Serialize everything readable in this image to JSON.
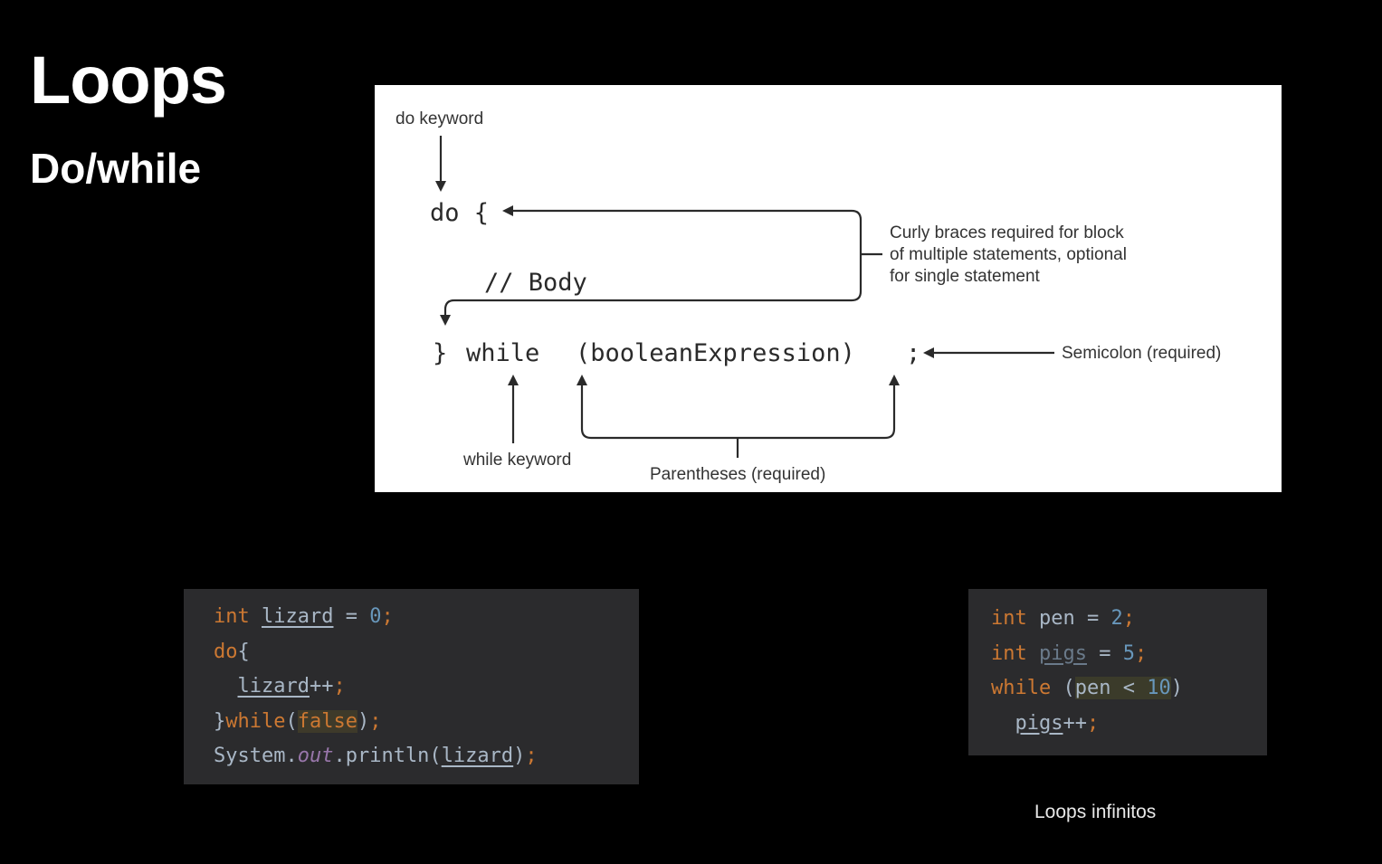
{
  "slide": {
    "title": "Loops",
    "subtitle": "Do/while",
    "caption": "Loops infinitos"
  },
  "diagram": {
    "code_do": "do  {",
    "code_body": "// Body",
    "code_close": "}",
    "code_while": "while",
    "code_expr": "(booleanExpression)",
    "code_semi": ";",
    "label_do_keyword": "do keyword",
    "label_braces_1": "Curly braces required for block",
    "label_braces_2": "of multiple statements, optional",
    "label_braces_3": "for single statement",
    "label_semicolon": "Semicolon (required)",
    "label_while_keyword": "while keyword",
    "label_parentheses": "Parentheses (required)"
  },
  "code_left": {
    "lines": [
      [
        {
          "t": "int",
          "c": "kw"
        },
        {
          "t": " ",
          "c": ""
        },
        {
          "t": "lizard",
          "c": "var"
        },
        {
          "t": " = ",
          "c": ""
        },
        {
          "t": "0",
          "c": "num"
        },
        {
          "t": ";",
          "c": "pun"
        }
      ],
      [
        {
          "t": "do",
          "c": "kw"
        },
        {
          "t": "{",
          "c": ""
        }
      ],
      [
        {
          "t": "  ",
          "c": ""
        },
        {
          "t": "lizard",
          "c": "var"
        },
        {
          "t": "++",
          "c": ""
        },
        {
          "t": ";",
          "c": "pun"
        }
      ],
      [
        {
          "t": "}",
          "c": ""
        },
        {
          "t": "while",
          "c": "kw"
        },
        {
          "t": "(",
          "c": ""
        },
        {
          "t": "false",
          "c": "kw hlb"
        },
        {
          "t": ")",
          "c": ""
        },
        {
          "t": ";",
          "c": "pun"
        }
      ],
      [
        {
          "t": "System.",
          "c": ""
        },
        {
          "t": "out",
          "c": "fld"
        },
        {
          "t": ".println(",
          "c": ""
        },
        {
          "t": "lizard",
          "c": "var"
        },
        {
          "t": ")",
          "c": ""
        },
        {
          "t": ";",
          "c": "pun"
        }
      ]
    ]
  },
  "code_right": {
    "lines": [
      [
        {
          "t": "int",
          "c": "kw"
        },
        {
          "t": " pen = ",
          "c": ""
        },
        {
          "t": "2",
          "c": "num"
        },
        {
          "t": ";",
          "c": "pun"
        }
      ],
      [
        {
          "t": "int",
          "c": "kw"
        },
        {
          "t": " ",
          "c": ""
        },
        {
          "t": "pigs",
          "c": "var dim"
        },
        {
          "t": " = ",
          "c": ""
        },
        {
          "t": "5",
          "c": "num"
        },
        {
          "t": ";",
          "c": "pun"
        }
      ],
      [
        {
          "t": "while",
          "c": "kw"
        },
        {
          "t": " (",
          "c": ""
        },
        {
          "t": "pen < ",
          "c": "hl"
        },
        {
          "t": "10",
          "c": "num hl"
        },
        {
          "t": ")",
          "c": ""
        }
      ],
      [
        {
          "t": "  ",
          "c": ""
        },
        {
          "t": "pigs",
          "c": "var"
        },
        {
          "t": "++",
          "c": ""
        },
        {
          "t": ";",
          "c": "pun"
        }
      ]
    ]
  }
}
